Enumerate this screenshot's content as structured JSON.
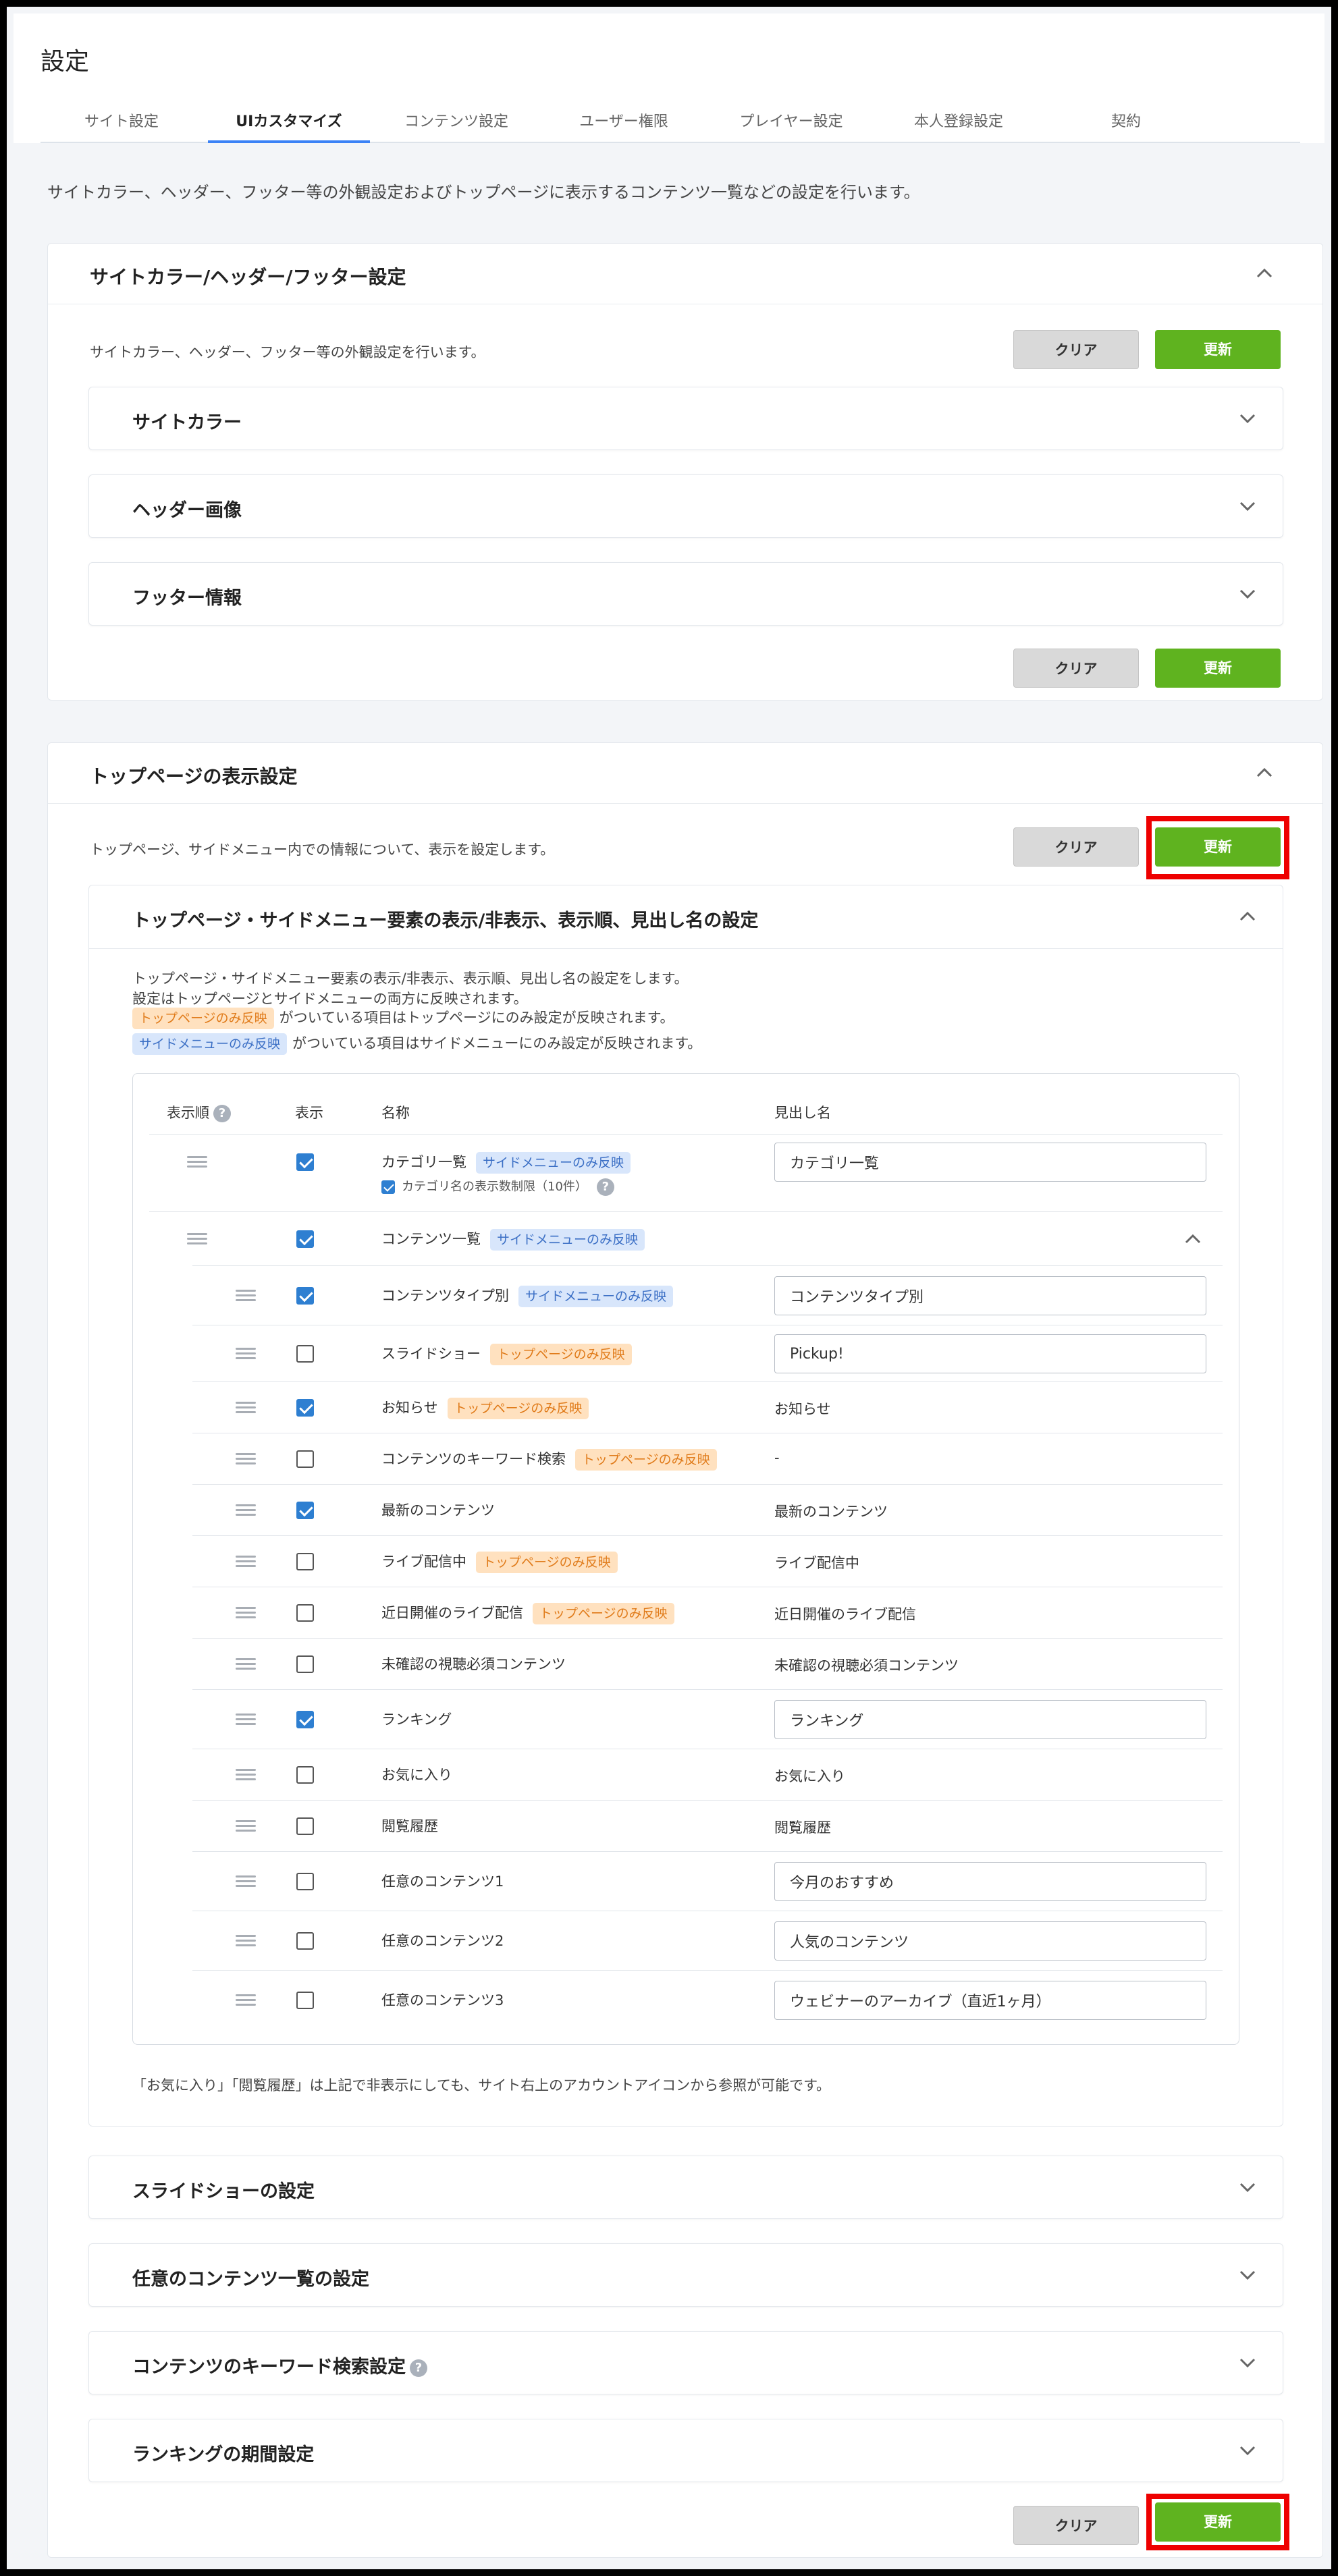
{
  "page": {
    "title": "設定"
  },
  "tabs": [
    "サイト設定",
    "UIカスタマイズ",
    "コンテンツ設定",
    "ユーザー権限",
    "プレイヤー設定",
    "本人登録設定",
    "契約"
  ],
  "intro": "サイトカラー、ヘッダー、フッター等の外観設定およびトップページに表示するコンテンツ一覧などの設定を行います。",
  "buttons": {
    "clear": "クリア",
    "update": "更新"
  },
  "colors": {
    "update_button": "#5fb31f",
    "clear_button": "#d9d9d9",
    "highlight_box": "#ee0000",
    "checkbox_checked": "#2e7fd1"
  },
  "section1": {
    "title": "サイトカラー/ヘッダー/フッター設定",
    "description": "サイトカラー、ヘッダー、フッター等の外観設定を行います。",
    "accordions": [
      "サイトカラー",
      "ヘッダー画像",
      "フッター情報"
    ]
  },
  "section2": {
    "title": "トップページの表示設定",
    "description": "トップページ、サイドメニュー内での情報について、表示を設定します。",
    "sub": {
      "title": "トップページ・サイドメニュー要素の表示/非表示、表示順、見出し名の設定",
      "notes": [
        "トップページ・サイドメニュー要素の表示/非表示、表示順、見出し名の設定をします。",
        "設定はトップページとサイドメニューの両方に反映されます。"
      ],
      "legend_top_suffix": "がついている項目はトップページにのみ設定が反映されます。",
      "legend_side_suffix": "がついている項目はサイドメニューにのみ設定が反映されます。",
      "columns": {
        "order": "表示順",
        "display": "表示",
        "name": "名称",
        "heading": "見出し名"
      },
      "help_glyph": "?",
      "badges": {
        "top": "トップページのみ反映",
        "side": "サイドメニューのみ反映"
      },
      "category_limit_label": "カテゴリ名の表示数制限（10件）",
      "rows": [
        {
          "name": "カテゴリ一覧",
          "badge": "side",
          "checked": true,
          "heading": "カテゴリ一覧",
          "input": true
        },
        {
          "name": "コンテンツ一覧",
          "badge": "side",
          "checked": true,
          "heading": "",
          "input": false
        },
        {
          "name": "コンテンツタイプ別",
          "badge": "side",
          "checked": true,
          "heading": "コンテンツタイプ別",
          "input": true
        },
        {
          "name": "スライドショー",
          "badge": "top",
          "checked": false,
          "heading": "Pickup!",
          "input": true
        },
        {
          "name": "お知らせ",
          "badge": "top",
          "checked": true,
          "heading": "お知らせ",
          "input": false
        },
        {
          "name": "コンテンツのキーワード検索",
          "badge": "top",
          "checked": false,
          "heading": "-",
          "input": false
        },
        {
          "name": "最新のコンテンツ",
          "badge": "",
          "checked": true,
          "heading": "最新のコンテンツ",
          "input": false
        },
        {
          "name": "ライブ配信中",
          "badge": "top",
          "checked": false,
          "heading": "ライブ配信中",
          "input": false
        },
        {
          "name": "近日開催のライブ配信",
          "badge": "top",
          "checked": false,
          "heading": "近日開催のライブ配信",
          "input": false
        },
        {
          "name": "未確認の視聴必須コンテンツ",
          "badge": "",
          "checked": false,
          "heading": "未確認の視聴必須コンテンツ",
          "input": false
        },
        {
          "name": "ランキング",
          "badge": "",
          "checked": true,
          "heading": "ランキング",
          "input": true
        },
        {
          "name": "お気に入り",
          "badge": "",
          "checked": false,
          "heading": "お気に入り",
          "input": false
        },
        {
          "name": "閲覧履歴",
          "badge": "",
          "checked": false,
          "heading": "閲覧履歴",
          "input": false
        },
        {
          "name": "任意のコンテンツ1",
          "badge": "",
          "checked": false,
          "heading": "今月のおすすめ",
          "input": true
        },
        {
          "name": "任意のコンテンツ2",
          "badge": "",
          "checked": false,
          "heading": "人気のコンテンツ",
          "input": true
        },
        {
          "name": "任意のコンテンツ3",
          "badge": "",
          "checked": false,
          "heading": "ウェビナーのアーカイブ（直近1ヶ月）",
          "input": true
        }
      ],
      "footer_note": "「お気に入り」「閲覧履歴」は上記で非表示にしても、サイト右上のアカウントアイコンから参照が可能です。"
    },
    "accordions": [
      "スライドショーの設定",
      "任意のコンテンツ一覧の設定",
      "コンテンツのキーワード検索設定",
      "ランキングの期間設定"
    ]
  }
}
